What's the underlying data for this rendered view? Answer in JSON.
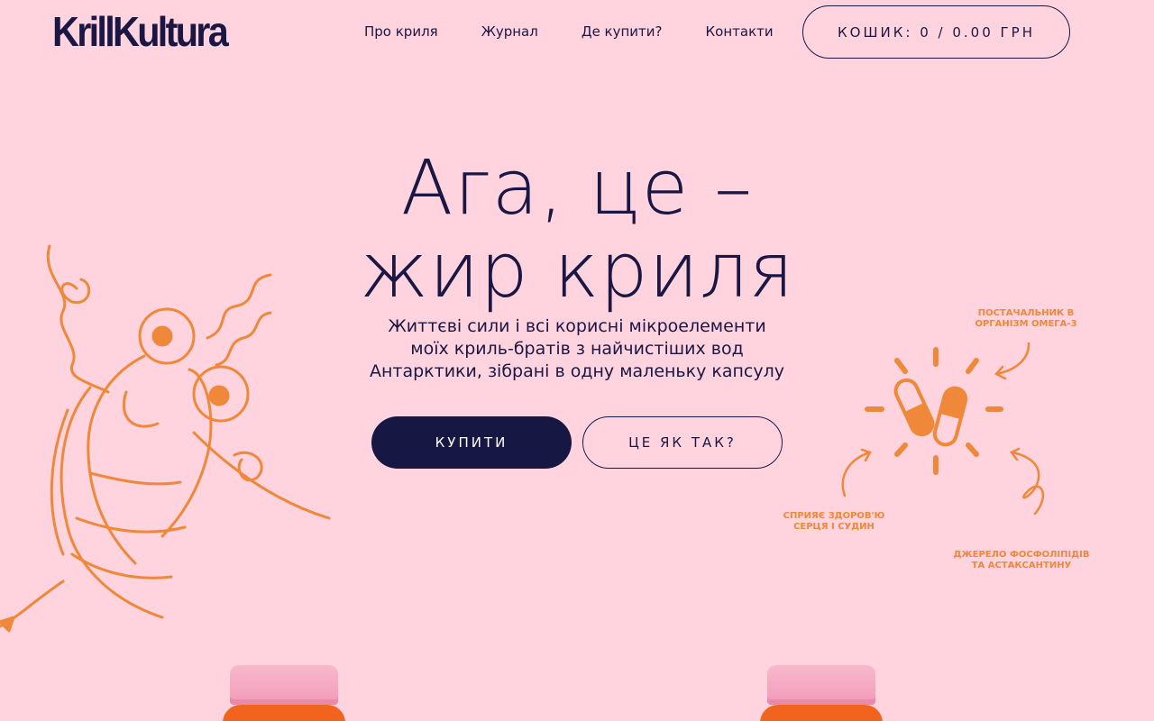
{
  "brand": {
    "logo": "KrillKultura"
  },
  "nav": {
    "items": [
      "Про криля",
      "Журнал",
      "Де купити?",
      "Контакти"
    ],
    "cart_label": "КОШИК: 0 / 0.00 ГРН"
  },
  "hero": {
    "title_line1": "Ага, це –",
    "title_line2": "жир криля",
    "subtitle_lines": [
      "Життєві сили і всі корисні мікроелементи",
      "моїх криль-братів з найчистіших вод",
      "Антарктики, зібрані в одну маленьку капсулу"
    ],
    "buy_label": "КУПИТИ",
    "how_label": "ЦЕ ЯК ТАК?"
  },
  "annotations": {
    "omega_line1": "ПОСТАЧАЛЬНИК В",
    "omega_line2": "ОРГАНІЗМ ОМЕГА-3",
    "heart_line1": "СПРИЯЄ ЗДОРОВ'Ю",
    "heart_line2": "СЕРЦЯ І СУДИН",
    "phospho_line1": "ДЖЕРЕЛО ФОСФОЛІПІДІВ",
    "phospho_line2": "ТА АСТАКСАНТИНУ"
  },
  "colors": {
    "background": "#ffd4de",
    "primary": "#1a1744",
    "accent": "#f0883a",
    "jar_orange": "#f2641d",
    "jar_lid": "#f7b9cd"
  }
}
